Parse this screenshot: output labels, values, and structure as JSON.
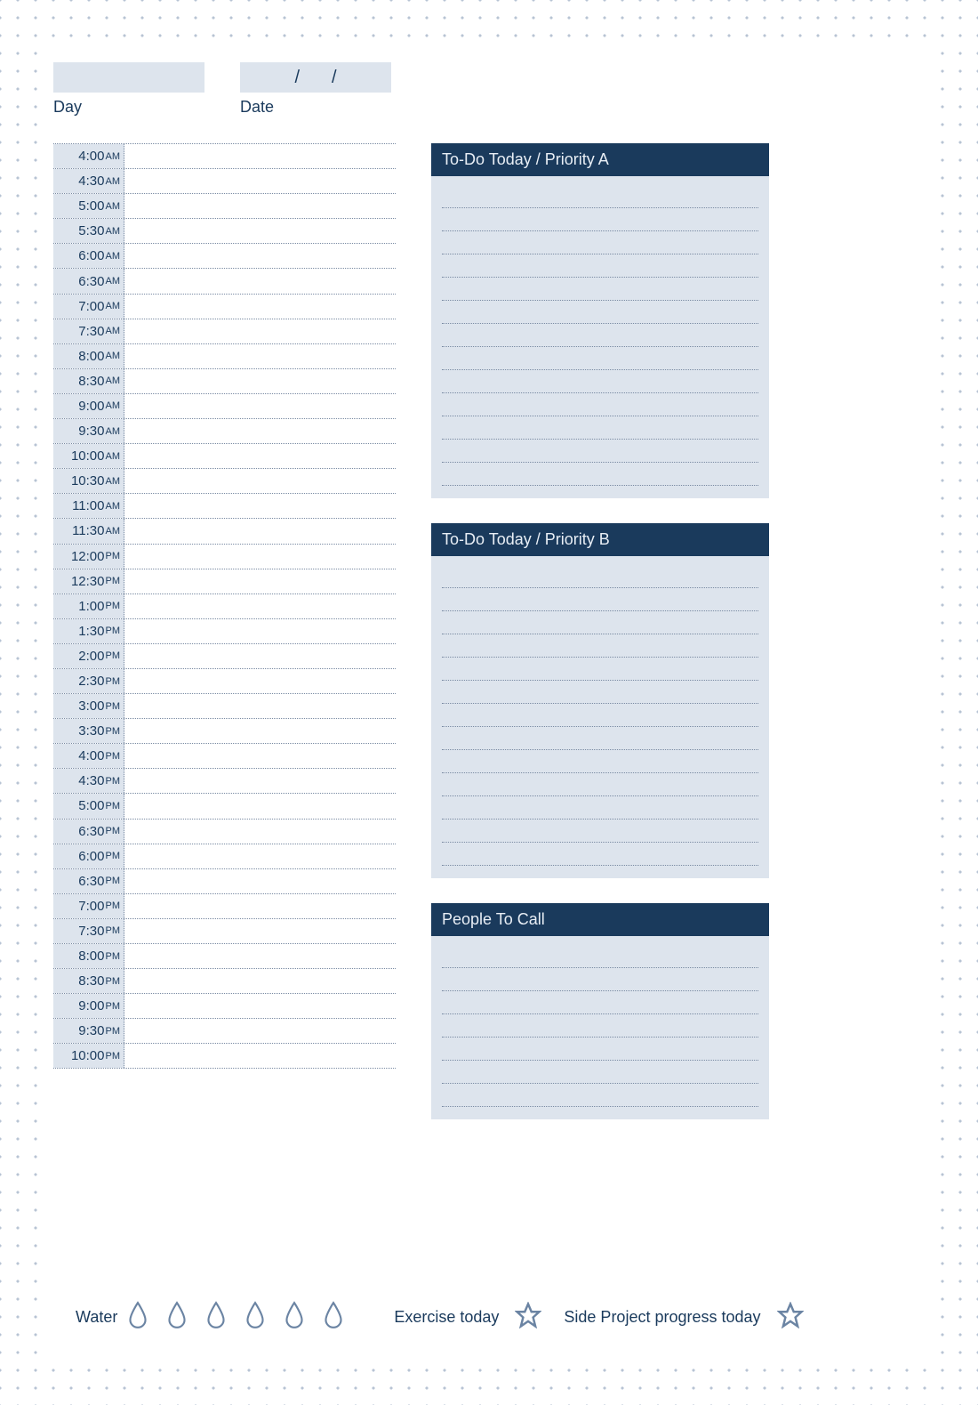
{
  "header": {
    "day_label": "Day",
    "date_label": "Date",
    "date_separator": "/"
  },
  "schedule": {
    "times": [
      {
        "t": "4:00",
        "p": "AM"
      },
      {
        "t": "4:30",
        "p": "AM"
      },
      {
        "t": "5:00",
        "p": "AM"
      },
      {
        "t": "5:30",
        "p": "AM"
      },
      {
        "t": "6:00",
        "p": "AM"
      },
      {
        "t": "6:30",
        "p": "AM"
      },
      {
        "t": "7:00",
        "p": "AM"
      },
      {
        "t": "7:30",
        "p": "AM"
      },
      {
        "t": "8:00",
        "p": "AM"
      },
      {
        "t": "8:30",
        "p": "AM"
      },
      {
        "t": "9:00",
        "p": "AM"
      },
      {
        "t": "9:30",
        "p": "AM"
      },
      {
        "t": "10:00",
        "p": "AM"
      },
      {
        "t": "10:30",
        "p": "AM"
      },
      {
        "t": "11:00",
        "p": "AM"
      },
      {
        "t": "11:30",
        "p": "AM"
      },
      {
        "t": "12:00",
        "p": "PM"
      },
      {
        "t": "12:30",
        "p": "PM"
      },
      {
        "t": "1:00",
        "p": "PM"
      },
      {
        "t": "1:30",
        "p": "PM"
      },
      {
        "t": "2:00",
        "p": "PM"
      },
      {
        "t": "2:30",
        "p": "PM"
      },
      {
        "t": "3:00",
        "p": "PM"
      },
      {
        "t": "3:30",
        "p": "PM"
      },
      {
        "t": "4:00",
        "p": "PM"
      },
      {
        "t": "4:30",
        "p": "PM"
      },
      {
        "t": "5:00",
        "p": "PM"
      },
      {
        "t": "6:30",
        "p": "PM"
      },
      {
        "t": "6:00",
        "p": "PM"
      },
      {
        "t": "6:30",
        "p": "PM"
      },
      {
        "t": "7:00",
        "p": "PM"
      },
      {
        "t": "7:30",
        "p": "PM"
      },
      {
        "t": "8:00",
        "p": "PM"
      },
      {
        "t": "8:30",
        "p": "PM"
      },
      {
        "t": "9:00",
        "p": "PM"
      },
      {
        "t": "9:30",
        "p": "PM"
      },
      {
        "t": "10:00",
        "p": "PM"
      }
    ]
  },
  "sections": {
    "priority_a": {
      "title": "To-Do Today / Priority A",
      "lines": 13
    },
    "priority_b": {
      "title": "To-Do Today / Priority B",
      "lines": 13
    },
    "people": {
      "title": "People To Call",
      "lines": 7
    }
  },
  "footer": {
    "water_label": "Water",
    "water_count": 6,
    "exercise_label": "Exercise today",
    "side_project_label": "Side Project progress today"
  },
  "colors": {
    "header_bg": "#1a3a5c",
    "panel_bg": "#dde4ed",
    "text": "#1a3a5c",
    "dotted": "#7a8ba3",
    "icon_stroke": "#6b84a3"
  }
}
